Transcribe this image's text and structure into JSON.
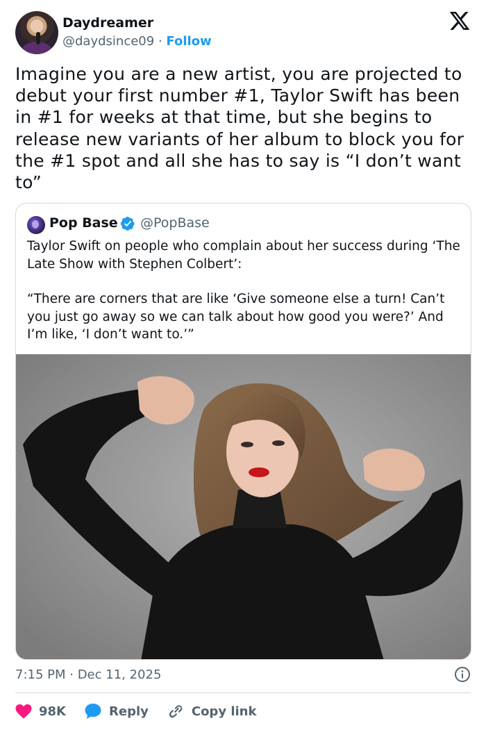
{
  "author": {
    "display_name": "Daydreamer",
    "handle": "@daydsince09",
    "separator": "·",
    "follow_label": "Follow"
  },
  "platform_icon": "x-logo-icon",
  "tweet": {
    "text": "Imagine you are a new artist, you are projected to debut your first number #1, Taylor Swift has been in #1 for weeks at that time, but she begins to release new variants of her album to block you for the #1 spot and all she has to say is “I don’t want to”"
  },
  "quoted": {
    "display_name": "Pop Base",
    "verified_icon": "verified-badge-icon",
    "handle": "@PopBase",
    "paragraph_1": "Taylor Swift on people who complain about her success during ‘The Late Show with Stephen Colbert’:",
    "paragraph_2": "“There are corners that are like ‘Give someone else a turn! Can’t you just go away so we can talk about how good you were?’ And I’m like, ‘I don’t want to.’”",
    "media": "photo-of-woman-in-black-turtleneck-flexing-arms"
  },
  "timestamp": "7:15 PM · Dec 11, 2025",
  "actions": {
    "likes_count": "98K",
    "reply_label": "Reply",
    "copy_label": "Copy link"
  },
  "colors": {
    "accent": "#1d9bf0",
    "like": "#f91880",
    "text": "#0f1419",
    "secondary": "#536471",
    "border": "#cfd9de"
  }
}
